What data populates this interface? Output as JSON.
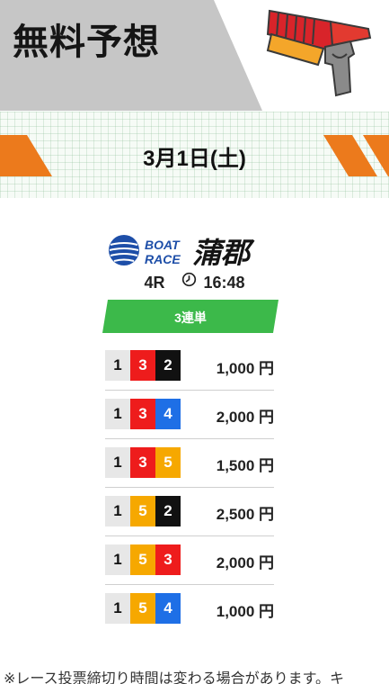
{
  "header": {
    "title": "無料予想",
    "icon": "ticket-gun-icon",
    "band_color": "#c6c6c6"
  },
  "date_band": {
    "date": "3月1日(土)",
    "stripe_color": "#ec7a1c"
  },
  "venue": {
    "logo_text_line1": "BOAT",
    "logo_text_line2": "RACE",
    "name": "蒲郡",
    "race_number": "4R",
    "time": "16:48",
    "clock_icon": "clock-icon"
  },
  "bet_type": {
    "label": "3連単",
    "color": "#3cb94a"
  },
  "boat_colors": {
    "1": "#e7e7e7",
    "2": "#111111",
    "3": "#ee1c1c",
    "4": "#1e6fe6",
    "5": "#f6a800"
  },
  "combinations": [
    {
      "first": "1",
      "second": "3",
      "third": "2",
      "amount": "1,000 円"
    },
    {
      "first": "1",
      "second": "3",
      "third": "4",
      "amount": "2,000 円"
    },
    {
      "first": "1",
      "second": "3",
      "third": "5",
      "amount": "1,500 円"
    },
    {
      "first": "1",
      "second": "5",
      "third": "2",
      "amount": "2,500 円"
    },
    {
      "first": "1",
      "second": "5",
      "third": "3",
      "amount": "2,000 円"
    },
    {
      "first": "1",
      "second": "5",
      "third": "4",
      "amount": "1,000 円"
    }
  ],
  "note": "※レース投票締切り時間は変わる場合があります。キ"
}
